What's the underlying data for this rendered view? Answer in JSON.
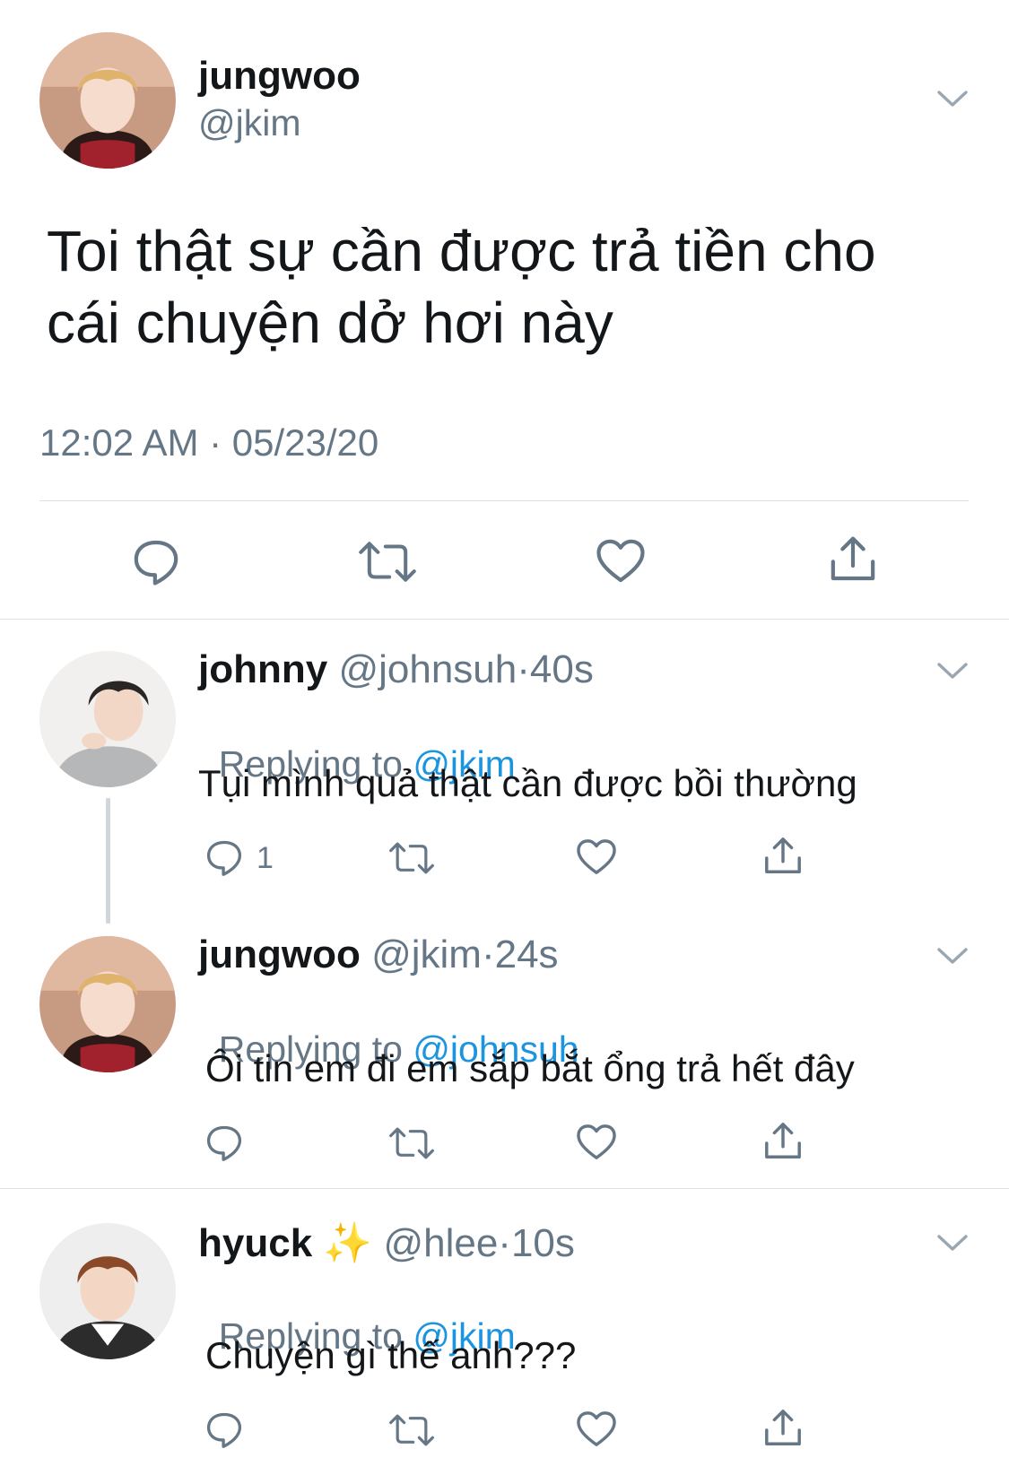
{
  "main_tweet": {
    "display_name": "jungwoo",
    "handle": "@jkim",
    "text_line1": "Toi thật sự cần được trả tiền cho",
    "text_line2": "cái chuyện dở hơi này",
    "timestamp": "12:02 AM · 05/23/20",
    "avatar_icon": "avatar-jungwoo"
  },
  "replies": [
    {
      "display_name": "johnny",
      "handle": "@johnsuh",
      "sep": "·",
      "age": "40s",
      "replying_prefix": "Replying to ",
      "replying_to": "@jkim",
      "text": "Tụi mình quả thật cần được bồi thường",
      "reply_count": "1",
      "avatar_icon": "avatar-johnny"
    },
    {
      "display_name": "jungwoo",
      "handle": "@jkim",
      "sep": "·",
      "age": "24s",
      "replying_prefix": "Replying to ",
      "replying_to": "@johnsuh",
      "text": "Ôi tin em đi em sắp bắt ổng trả hết đây",
      "reply_count": "",
      "avatar_icon": "avatar-jungwoo"
    },
    {
      "display_name": "hyuck",
      "emoji": "✨",
      "handle": "@hlee",
      "sep": "·",
      "age": "10s",
      "replying_prefix": "Replying to ",
      "replying_to": "@jkim",
      "text": "Chuyện gì thế anh???",
      "reply_count": "",
      "avatar_icon": "avatar-hyuck"
    }
  ],
  "colors": {
    "text": "#14171a",
    "secondary": "#657786",
    "link": "#1b95e0",
    "divider": "#dfe3e6"
  }
}
